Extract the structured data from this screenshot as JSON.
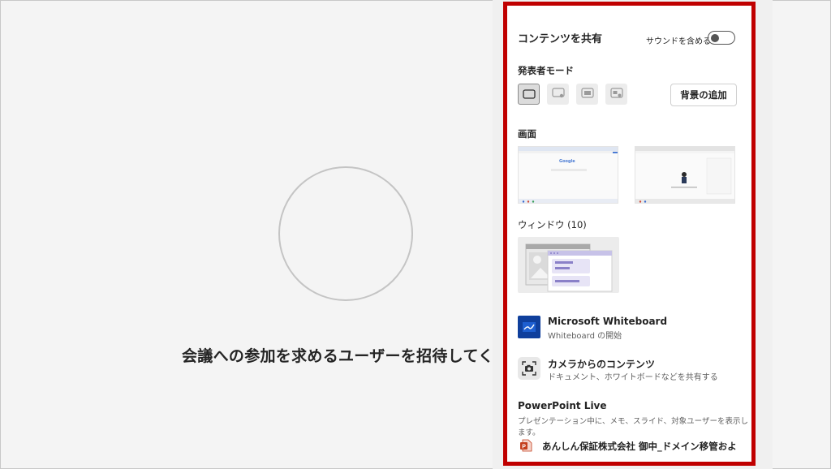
{
  "stage": {
    "invite_text": "会議への参加を求めるユーザーを招待してください"
  },
  "share_panel": {
    "title": "コンテンツを共有",
    "sound_label": "サウンドを含める",
    "sound_enabled": false,
    "presenter_mode": {
      "heading": "発表者モード",
      "modes": [
        {
          "icon": "standout-off-icon",
          "selected": true
        },
        {
          "icon": "standout-icon",
          "selected": false
        },
        {
          "icon": "side-by-side-icon",
          "selected": false
        },
        {
          "icon": "reporter-icon",
          "selected": false
        }
      ],
      "add_background_label": "背景の追加"
    },
    "screens": {
      "heading": "画面",
      "thumb1_logo": "Google"
    },
    "windows": {
      "heading": "ウィンドウ (10)"
    },
    "whiteboard": {
      "title": "Microsoft Whiteboard",
      "subtitle": "Whiteboard の開始"
    },
    "camera": {
      "title": "カメラからのコンテンツ",
      "subtitle": "ドキュメント、ホワイトボードなどを共有する"
    },
    "powerpoint": {
      "heading": "PowerPoint Live",
      "description": "プレゼンテーション中に、メモ、スライド、対象ユーザーを表示します。",
      "file_name": "あんしん保証株式会社 御中_ドメイン移管およ..."
    },
    "colors": {
      "highlight_border": "#c00000",
      "whiteboard_blue": "#0f3f9c",
      "ppt_red": "#c43e1c",
      "window_accent": "#8a80c8"
    }
  }
}
